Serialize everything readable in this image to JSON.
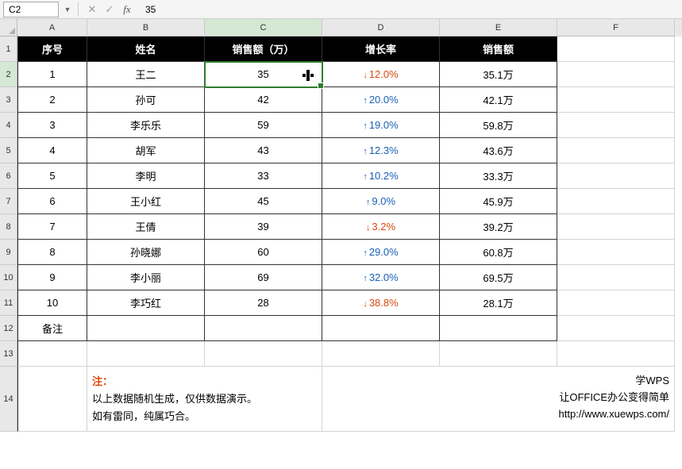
{
  "name_box": "C2",
  "formula_value": "35",
  "columns": [
    "A",
    "B",
    "C",
    "D",
    "E",
    "F"
  ],
  "row_numbers": [
    "1",
    "2",
    "3",
    "4",
    "5",
    "6",
    "7",
    "8",
    "9",
    "10",
    "11",
    "12",
    "13",
    "14"
  ],
  "headers": {
    "seq": "序号",
    "name": "姓名",
    "sales": "销售额（万）",
    "growth": "增长率",
    "sales2": "销售额"
  },
  "rows": [
    {
      "seq": "1",
      "name": "王二",
      "sales": "35",
      "growth": "12.0%",
      "dir": "down",
      "sales2": "35.1万"
    },
    {
      "seq": "2",
      "name": "孙可",
      "sales": "42",
      "growth": "20.0%",
      "dir": "up",
      "sales2": "42.1万"
    },
    {
      "seq": "3",
      "name": "李乐乐",
      "sales": "59",
      "growth": "19.0%",
      "dir": "up",
      "sales2": "59.8万"
    },
    {
      "seq": "4",
      "name": "胡军",
      "sales": "43",
      "growth": "12.3%",
      "dir": "up",
      "sales2": "43.6万"
    },
    {
      "seq": "5",
      "name": "李明",
      "sales": "33",
      "growth": "10.2%",
      "dir": "up",
      "sales2": "33.3万"
    },
    {
      "seq": "6",
      "name": "王小红",
      "sales": "45",
      "growth": "9.0%",
      "dir": "up",
      "sales2": "45.9万"
    },
    {
      "seq": "7",
      "name": "王倩",
      "sales": "39",
      "growth": "3.2%",
      "dir": "down",
      "sales2": "39.2万"
    },
    {
      "seq": "8",
      "name": "孙晓娜",
      "sales": "60",
      "growth": "29.0%",
      "dir": "up",
      "sales2": "60.8万"
    },
    {
      "seq": "9",
      "name": "李小丽",
      "sales": "69",
      "growth": "32.0%",
      "dir": "up",
      "sales2": "69.5万"
    },
    {
      "seq": "10",
      "name": "李巧红",
      "sales": "28",
      "growth": "38.8%",
      "dir": "down",
      "sales2": "28.1万"
    }
  ],
  "remark_label": "备注",
  "note": {
    "title": "注：",
    "line1": "以上数据随机生成，仅供数据演示。",
    "line2": "如有雷同，纯属巧合。"
  },
  "promo": {
    "line1": "学WPS",
    "line2": "让OFFICE办公变得简单",
    "url": "http://www.xuewps.com/"
  },
  "active_cell": "C2"
}
